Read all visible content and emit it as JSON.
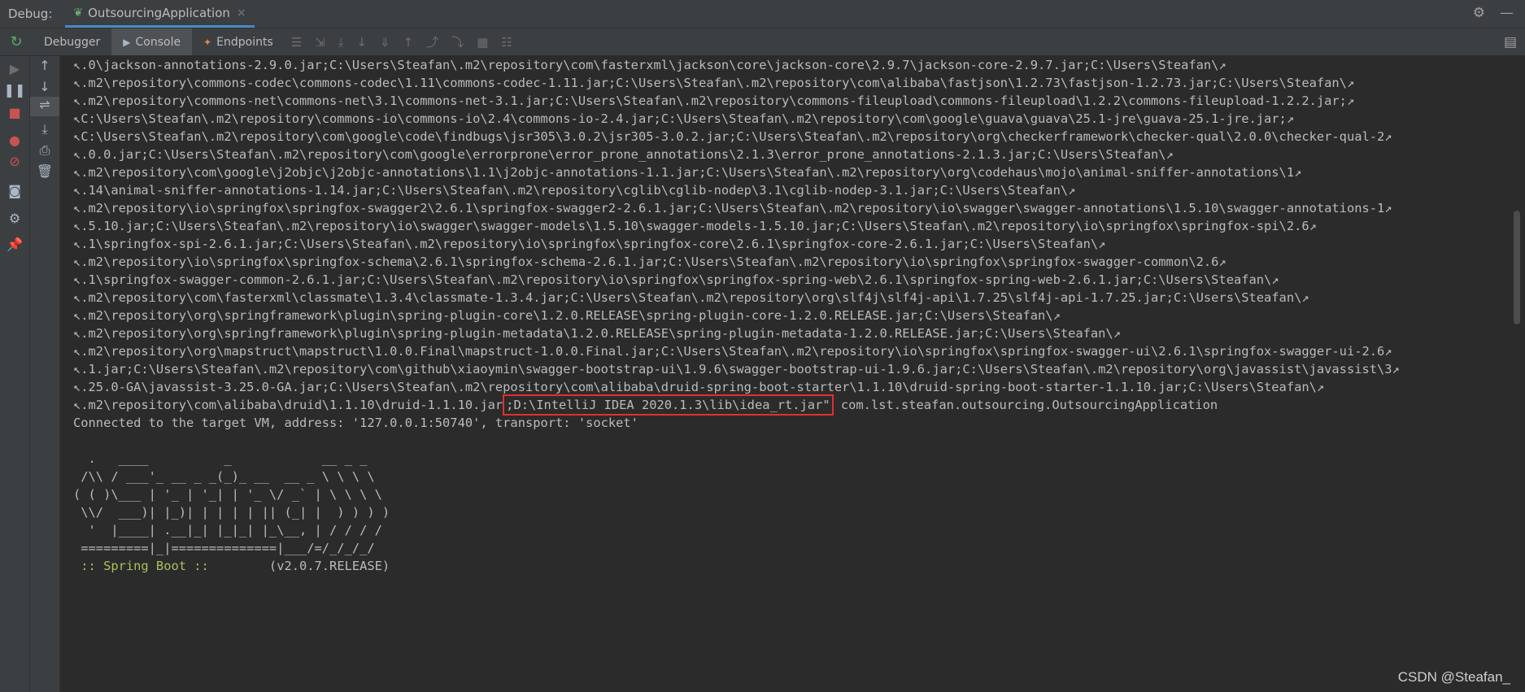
{
  "titlebar": {
    "debug_label": "Debug:",
    "tab_title": "OutsourcingApplication",
    "close_glyph": "×",
    "settings_glyph": "⚙",
    "minimize_glyph": "—"
  },
  "toolbar": {
    "tabs": [
      {
        "label": "Debugger",
        "icon": ""
      },
      {
        "label": "Console",
        "icon": "▶"
      },
      {
        "label": "Endpoints",
        "icon": "✦"
      }
    ]
  },
  "console": {
    "lines": [
      "↖.0\\jackson-annotations-2.9.0.jar;C:\\Users\\Steafan\\.m2\\repository\\com\\fasterxml\\jackson\\core\\jackson-core\\2.9.7\\jackson-core-2.9.7.jar;C:\\Users\\Steafan\\↗",
      "↖.m2\\repository\\commons-codec\\commons-codec\\1.11\\commons-codec-1.11.jar;C:\\Users\\Steafan\\.m2\\repository\\com\\alibaba\\fastjson\\1.2.73\\fastjson-1.2.73.jar;C:\\Users\\Steafan\\↗",
      "↖.m2\\repository\\commons-net\\commons-net\\3.1\\commons-net-3.1.jar;C:\\Users\\Steafan\\.m2\\repository\\commons-fileupload\\commons-fileupload\\1.2.2\\commons-fileupload-1.2.2.jar;↗",
      "↖C:\\Users\\Steafan\\.m2\\repository\\commons-io\\commons-io\\2.4\\commons-io-2.4.jar;C:\\Users\\Steafan\\.m2\\repository\\com\\google\\guava\\guava\\25.1-jre\\guava-25.1-jre.jar;↗",
      "↖C:\\Users\\Steafan\\.m2\\repository\\com\\google\\code\\findbugs\\jsr305\\3.0.2\\jsr305-3.0.2.jar;C:\\Users\\Steafan\\.m2\\repository\\org\\checkerframework\\checker-qual\\2.0.0\\checker-qual-2↗",
      "↖.0.0.jar;C:\\Users\\Steafan\\.m2\\repository\\com\\google\\errorprone\\error_prone_annotations\\2.1.3\\error_prone_annotations-2.1.3.jar;C:\\Users\\Steafan\\↗",
      "↖.m2\\repository\\com\\google\\j2objc\\j2objc-annotations\\1.1\\j2objc-annotations-1.1.jar;C:\\Users\\Steafan\\.m2\\repository\\org\\codehaus\\mojo\\animal-sniffer-annotations\\1↗",
      "↖.14\\animal-sniffer-annotations-1.14.jar;C:\\Users\\Steafan\\.m2\\repository\\cglib\\cglib-nodep\\3.1\\cglib-nodep-3.1.jar;C:\\Users\\Steafan\\↗",
      "↖.m2\\repository\\io\\springfox\\springfox-swagger2\\2.6.1\\springfox-swagger2-2.6.1.jar;C:\\Users\\Steafan\\.m2\\repository\\io\\swagger\\swagger-annotations\\1.5.10\\swagger-annotations-1↗",
      "↖.5.10.jar;C:\\Users\\Steafan\\.m2\\repository\\io\\swagger\\swagger-models\\1.5.10\\swagger-models-1.5.10.jar;C:\\Users\\Steafan\\.m2\\repository\\io\\springfox\\springfox-spi\\2.6↗",
      "↖.1\\springfox-spi-2.6.1.jar;C:\\Users\\Steafan\\.m2\\repository\\io\\springfox\\springfox-core\\2.6.1\\springfox-core-2.6.1.jar;C:\\Users\\Steafan\\↗",
      "↖.m2\\repository\\io\\springfox\\springfox-schema\\2.6.1\\springfox-schema-2.6.1.jar;C:\\Users\\Steafan\\.m2\\repository\\io\\springfox\\springfox-swagger-common\\2.6↗",
      "↖.1\\springfox-swagger-common-2.6.1.jar;C:\\Users\\Steafan\\.m2\\repository\\io\\springfox\\springfox-spring-web\\2.6.1\\springfox-spring-web-2.6.1.jar;C:\\Users\\Steafan\\↗",
      "↖.m2\\repository\\com\\fasterxml\\classmate\\1.3.4\\classmate-1.3.4.jar;C:\\Users\\Steafan\\.m2\\repository\\org\\slf4j\\slf4j-api\\1.7.25\\slf4j-api-1.7.25.jar;C:\\Users\\Steafan\\↗",
      "↖.m2\\repository\\org\\springframework\\plugin\\spring-plugin-core\\1.2.0.RELEASE\\spring-plugin-core-1.2.0.RELEASE.jar;C:\\Users\\Steafan\\↗",
      "↖.m2\\repository\\org\\springframework\\plugin\\spring-plugin-metadata\\1.2.0.RELEASE\\spring-plugin-metadata-1.2.0.RELEASE.jar;C:\\Users\\Steafan\\↗",
      "↖.m2\\repository\\org\\mapstruct\\mapstruct\\1.0.0.Final\\mapstruct-1.0.0.Final.jar;C:\\Users\\Steafan\\.m2\\repository\\io\\springfox\\springfox-swagger-ui\\2.6.1\\springfox-swagger-ui-2.6↗",
      "↖.1.jar;C:\\Users\\Steafan\\.m2\\repository\\com\\github\\xiaoymin\\swagger-bootstrap-ui\\1.9.6\\swagger-bootstrap-ui-1.9.6.jar;C:\\Users\\Steafan\\.m2\\repository\\org\\javassist\\javassist\\3↗",
      "↖.25.0-GA\\javassist-3.25.0-GA.jar;C:\\Users\\Steafan\\.m2\\repository\\com\\alibaba\\druid-spring-boot-starter\\1.1.10\\druid-spring-boot-starter-1.1.10.jar;C:\\Users\\Steafan\\↗"
    ],
    "last_cp_before": "↖.m2\\repository\\com\\alibaba\\druid\\1.1.10\\druid-1.1.10.jar",
    "last_cp_highlight": ";D:\\IntelliJ IDEA 2020.1.3\\lib\\idea_rt.jar\"",
    "last_cp_after": " com.lst.steafan.outsourcing.OutsourcingApplication",
    "connected": "Connected to the target VM, address: '127.0.0.1:50740', transport: 'socket'",
    "banner": [
      "  .   ____          _            __ _ _",
      " /\\\\ / ___'_ __ _ _(_)_ __  __ _ \\ \\ \\ \\",
      "( ( )\\___ | '_ | '_| | '_ \\/ _` | \\ \\ \\ \\",
      " \\\\/  ___)| |_)| | | | | || (_| |  ) ) ) )",
      "  '  |____| .__|_| |_|_| |_\\__, | / / / /",
      " =========|_|==============|___/=/_/_/_/"
    ],
    "spring_boot_label": " :: Spring Boot ::        ",
    "spring_boot_version": "(v2.0.7.RELEASE)"
  },
  "watermark": "CSDN @Steafan_"
}
